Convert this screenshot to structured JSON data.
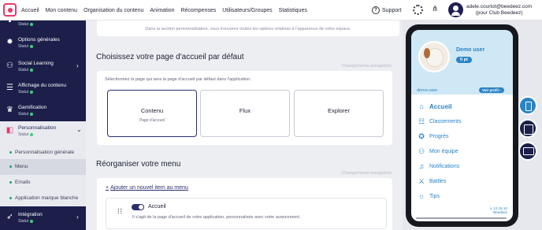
{
  "topnav": {
    "items": [
      "Accueil",
      "Mon contenu",
      "Organisation du contenu",
      "Animation",
      "Récompenses",
      "Utilisateurs/Groupes",
      "Statistiques"
    ],
    "support": "Support",
    "user_email": "adele.courtot@beedeez.com",
    "user_club": "(pour Club Beedeez)"
  },
  "sidebar": {
    "status_label": "Statut",
    "items": [
      {
        "label": "Options générales"
      },
      {
        "label": "Social Learning"
      },
      {
        "label": "Affichage du contenu"
      },
      {
        "label": "Gamification"
      },
      {
        "label": "Personnalisation"
      },
      {
        "label": "Intégration"
      }
    ],
    "subitems": [
      "Personnalisation générale",
      "Menu",
      "Emails",
      "Application marque blanche"
    ]
  },
  "main": {
    "intro": "Dans la section personnalisation, vous trouverez toutes les options relatives à l'apparence de votre espace.",
    "section1_title": "Choisissez votre page d'accueil par défaut",
    "saved": "Changements enregistrés",
    "section1_desc": "Sélectionnez la page qui sera la page d'accueil par défaut dans l'application.",
    "options": [
      {
        "title": "Contenu",
        "subtitle": "Page d'accueil"
      },
      {
        "title": "Flux",
        "subtitle": ""
      },
      {
        "title": "Explorer",
        "subtitle": ""
      }
    ],
    "section2_title": "Réorganiser votre menu",
    "add_item": "Ajouter un nouvel item au menu",
    "menu_row": {
      "title": "Accueil",
      "desc": "Il s'agit de la page d'accueil de votre application, personnalisée avec votre avancement."
    }
  },
  "phone": {
    "name": "Demo user",
    "points": "0 pt",
    "username": "demo-user",
    "profile_button": "Voir profil",
    "menu": [
      "Accueil",
      "Classements",
      "Progrès",
      "Mon équipe",
      "Notifications",
      "Battles",
      "Tips"
    ],
    "version": "v. 12.15.10",
    "brand": "Beedeez"
  },
  "colors": {
    "sidebar": "#1c1f4a",
    "accent": "#2a2f6c",
    "phone_accent": "#2a84c6",
    "status_ok": "#3fd17b"
  }
}
